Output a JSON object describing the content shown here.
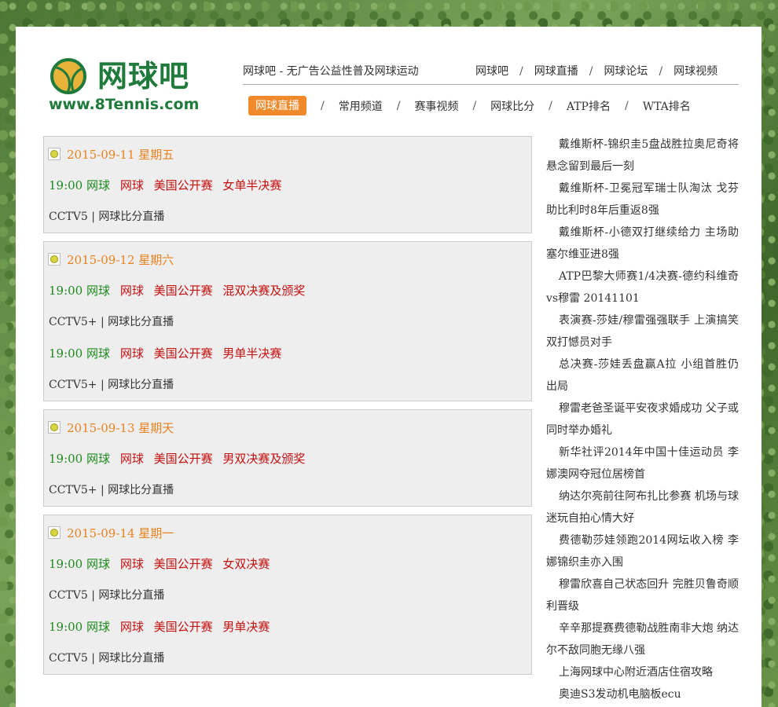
{
  "header": {
    "logo_cn": "网球吧",
    "logo_url": "www.8Tennis.com",
    "tagline": "网球吧 - 无广告公益性普及网球运动",
    "top_links": [
      "网球吧",
      "网球直播",
      "网球论坛",
      "网球视频"
    ],
    "main_nav": [
      "网球直播",
      "常用频道",
      "赛事视频",
      "网球比分",
      "ATP排名",
      "WTA排名"
    ],
    "active_nav": "网球直播"
  },
  "schedule": [
    {
      "date": "2015-09-11 星期五",
      "matches": [
        {
          "time": "19:00",
          "sport1": "网球",
          "sport2": "网球",
          "league": "美国公开赛",
          "event": "女单半决赛",
          "channel": "CCTV5 | 网球比分直播"
        }
      ]
    },
    {
      "date": "2015-09-12 星期六",
      "matches": [
        {
          "time": "19:00",
          "sport1": "网球",
          "sport2": "网球",
          "league": "美国公开赛",
          "event": "混双决赛及颁奖",
          "channel": "CCTV5+ | 网球比分直播"
        },
        {
          "time": "19:00",
          "sport1": "网球",
          "sport2": "网球",
          "league": "美国公开赛",
          "event": "男单半决赛",
          "channel": "CCTV5+ | 网球比分直播"
        }
      ]
    },
    {
      "date": "2015-09-13 星期天",
      "matches": [
        {
          "time": "19:00",
          "sport1": "网球",
          "sport2": "网球",
          "league": "美国公开赛",
          "event": "男双决赛及颁奖",
          "channel": "CCTV5+ | 网球比分直播"
        }
      ]
    },
    {
      "date": "2015-09-14 星期一",
      "matches": [
        {
          "time": "19:00",
          "sport1": "网球",
          "sport2": "网球",
          "league": "美国公开赛",
          "event": "女双决赛",
          "channel": "CCTV5 | 网球比分直播"
        },
        {
          "time": "19:00",
          "sport1": "网球",
          "sport2": "网球",
          "league": "美国公开赛",
          "event": "男单决赛",
          "channel": "CCTV5 | 网球比分直播"
        }
      ]
    }
  ],
  "sidebar": {
    "news": [
      "戴维斯杯-锦织圭5盘战胜拉奥尼奇将悬念留到最后一刻",
      "戴维斯杯-卫冕冠军瑞士队淘汰 戈芬助比利时8年后重返8强",
      "戴维斯杯-小德双打继续给力 主场助塞尔维亚进8强",
      "ATP巴黎大师赛1/4决赛-德约科维奇vs穆雷 20141101",
      "表演赛-莎娃/穆雷强强联手 上演搞笑双打憾员对手",
      "总决赛-莎娃丢盘赢A拉 小组首胜仍出局",
      "穆雷老爸圣诞平安夜求婚成功 父子或同时举办婚礼",
      "新华社评2014年中国十佳运动员 李娜澳网夺冠位居榜首",
      "纳达尔亮前往阿布扎比参赛 机场与球迷玩自拍心情大好",
      "费德勒莎娃领跑2014网坛收入榜 李娜锦织圭亦入围",
      "穆雷欣喜自己状态回升 完胜贝鲁奇顺利晋级",
      "辛辛那提赛费德勒战胜南非大炮 纳达尔不敌同胞无缘八强",
      "上海网球中心附近酒店住宿攻略",
      "奥迪S3发动机电脑板ecu"
    ]
  }
}
